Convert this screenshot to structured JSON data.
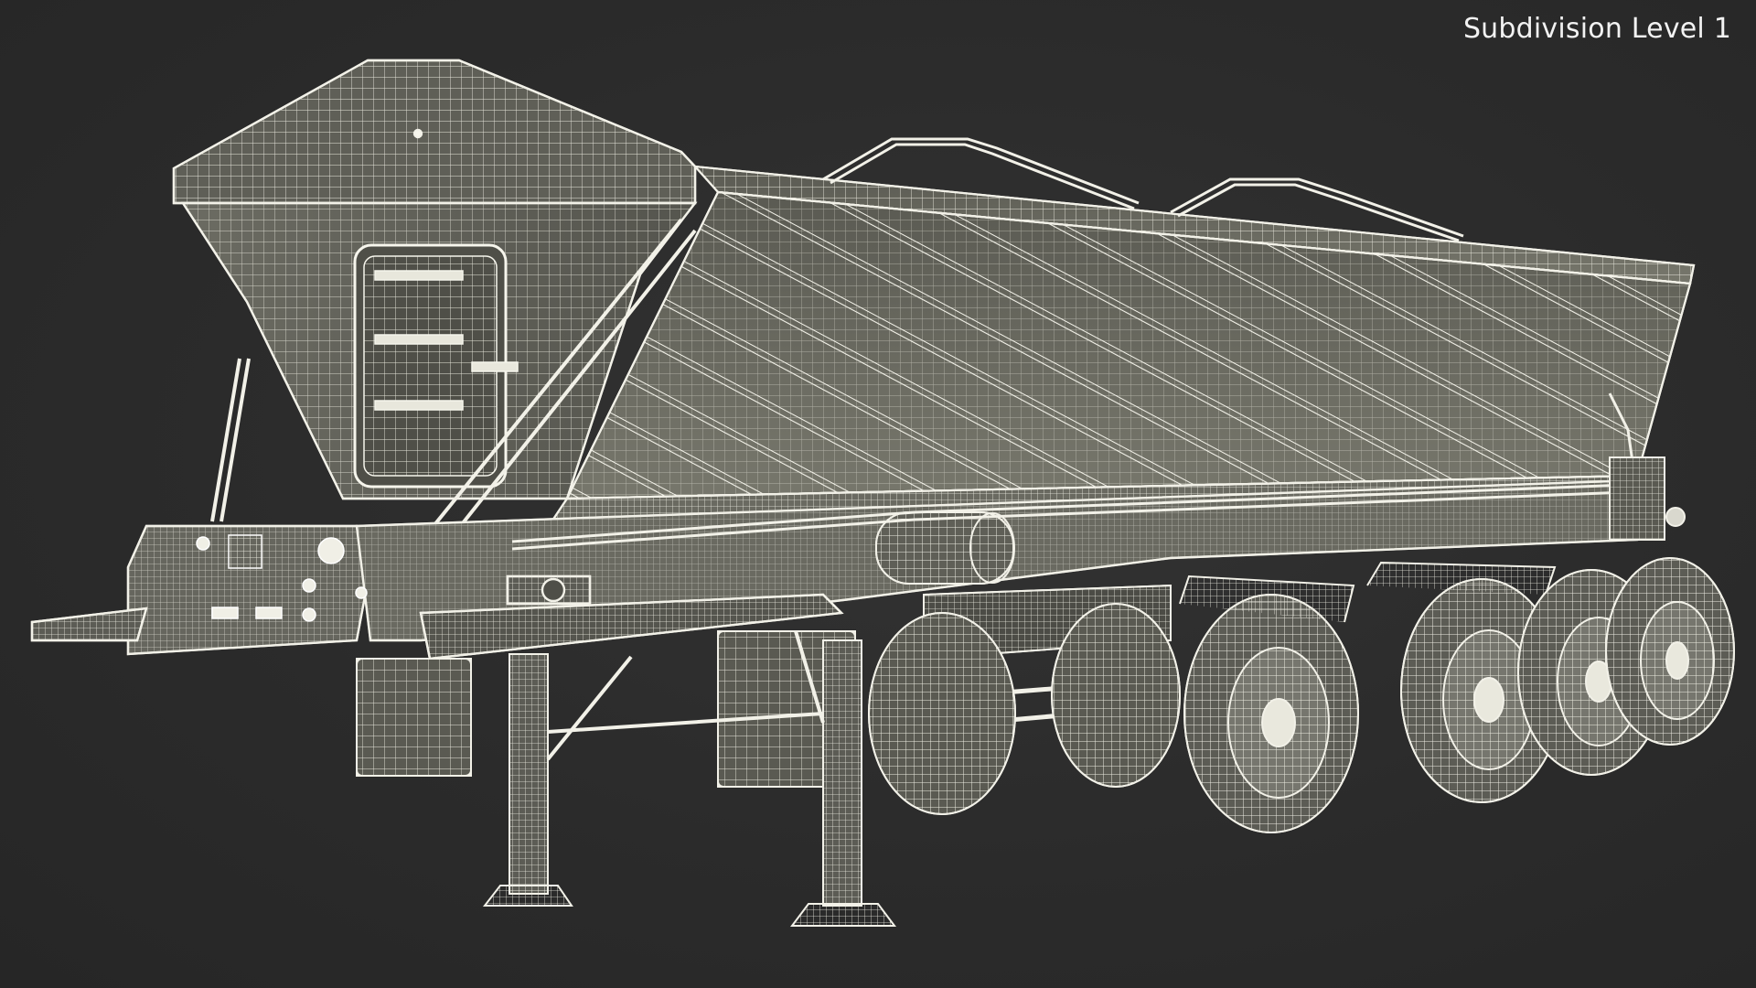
{
  "viewport": {
    "label": "Subdivision Level 1",
    "background_color": "#2b2b2b",
    "wire_color": "#f0efe6",
    "shade_color": "#6f6f66"
  },
  "model": {
    "icon": "side-dump-trailer-wireframe-icon"
  }
}
